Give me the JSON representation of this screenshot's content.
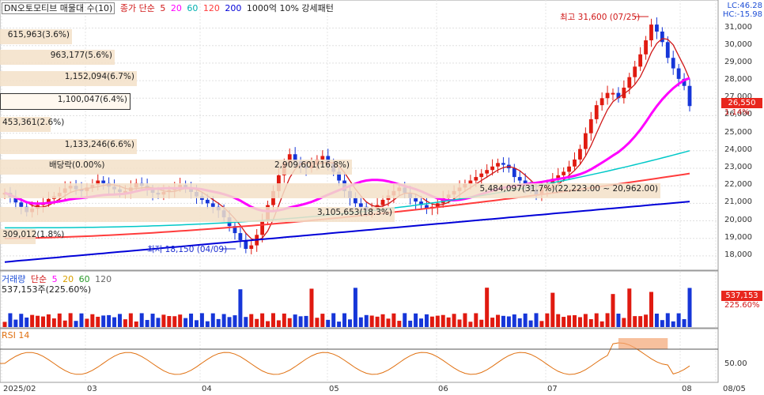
{
  "header": {
    "title": "DN오토모티브 매물대 수(10)",
    "ind_label": "종가 단순",
    "ma_periods": [
      "5",
      "20",
      "60",
      "120",
      "200"
    ],
    "ma_colors": [
      "#d01818",
      "#ff00ff",
      "#00c8c8",
      "#ff3c3c",
      "#0000d8"
    ],
    "tail": "1000억 10% 강세패턴"
  },
  "corner": {
    "lc": "LC:46.28",
    "hc": "HC:-15.98"
  },
  "price_axis": {
    "ticks": [
      "31,000",
      "30,000",
      "29,000",
      "28,000",
      "27,000",
      "26,000",
      "25,000",
      "24,000",
      "23,000",
      "22,000",
      "21,000",
      "20,000",
      "19,000",
      "18,000"
    ],
    "current": "26,550",
    "change": "1.14%"
  },
  "volume_profile": [
    {
      "label": "615,963(3.6%)",
      "width": 0.1
    },
    {
      "label": "963,177(5.6%)",
      "width": 0.16
    },
    {
      "label": "1,152,094(6.7%)",
      "width": 0.19
    },
    {
      "label": "1,100,047(6.4%)",
      "width": 0.18
    },
    {
      "label": "453,361(2.6%)",
      "width": 0.07
    },
    {
      "label": "1,133,246(6.6%)",
      "width": 0.19
    },
    {
      "label": "2,909,601(16.8%)",
      "width": 0.49
    },
    {
      "label": "5,484,097(31.7%)(22,223.00 ~ 20,962.00)",
      "width": 0.92
    },
    {
      "label": "3,105,653(18.3%)",
      "width": 0.55
    },
    {
      "label": "309,012(1.8%)",
      "width": 0.05
    }
  ],
  "annotations": {
    "high": "최고 31,600 (07/25)",
    "low": "최저 18,150 (04/09)",
    "dividend": "배당락(0.00%)"
  },
  "volume_panel": {
    "label": "거래량",
    "ind_label": "단순",
    "periods": [
      "5",
      "20",
      "60",
      "120"
    ],
    "sub": "537,153주(225.60%)",
    "current": "537,153",
    "pct": "225.60%"
  },
  "rsi_panel": {
    "label": "RSI 14",
    "level": "50.00"
  },
  "x_axis": [
    "2025/02",
    "03",
    "04",
    "05",
    "06",
    "07",
    "08",
    "08/05"
  ],
  "chart_data": {
    "type": "candlestick",
    "title": "DN오토모티브 매물대 수(10)",
    "ylim": [
      17500,
      31700
    ],
    "y_ticks": [
      31000,
      30000,
      29000,
      28000,
      27000,
      26000,
      25000,
      24000,
      23000,
      22000,
      21000,
      20000,
      19000,
      18000
    ],
    "high": {
      "value": 31600,
      "date": "07/25"
    },
    "low": {
      "value": 18150,
      "date": "04/09"
    },
    "last_close": 26550,
    "closes": [
      21600,
      21350,
      21050,
      20800,
      20500,
      20700,
      20900,
      21050,
      21250,
      21400,
      21600,
      21850,
      22000,
      21800,
      21700,
      21900,
      22050,
      22300,
      22150,
      21950,
      21800,
      21650,
      21700,
      21900,
      22150,
      22000,
      21800,
      21600,
      21500,
      21650,
      21750,
      21900,
      22050,
      21900,
      21650,
      21400,
      21200,
      21000,
      20800,
      20600,
      20200,
      19700,
      19300,
      18900,
      18400,
      18600,
      19200,
      20000,
      20900,
      21700,
      22600,
      23300,
      23800,
      23400,
      23100,
      23000,
      23200,
      23500,
      23700,
      23300,
      22800,
      22300,
      21700,
      21300,
      21000,
      20800,
      20600,
      20700,
      20900,
      21200,
      21450,
      21700,
      21900,
      21600,
      21300,
      21100,
      20900,
      20700,
      20800,
      21000,
      21300,
      21500,
      21700,
      21900,
      22100,
      22300,
      22500,
      22700,
      22900,
      23100,
      23300,
      23200,
      23000,
      22500,
      22300,
      22000,
      21800,
      21500,
      21800,
      22100,
      22400,
      22600,
      22800,
      23100,
      23500,
      24100,
      25000,
      25800,
      26600,
      27000,
      27300,
      27300,
      27000,
      27600,
      28200,
      28800,
      29500,
      30300,
      31200,
      30800,
      30200,
      29300,
      28700,
      28100,
      27700,
      26550
    ],
    "ma_20_end": 27900,
    "ma_60_end": 24000,
    "ma_120_end": 22700,
    "ma_200_end": 21100
  }
}
